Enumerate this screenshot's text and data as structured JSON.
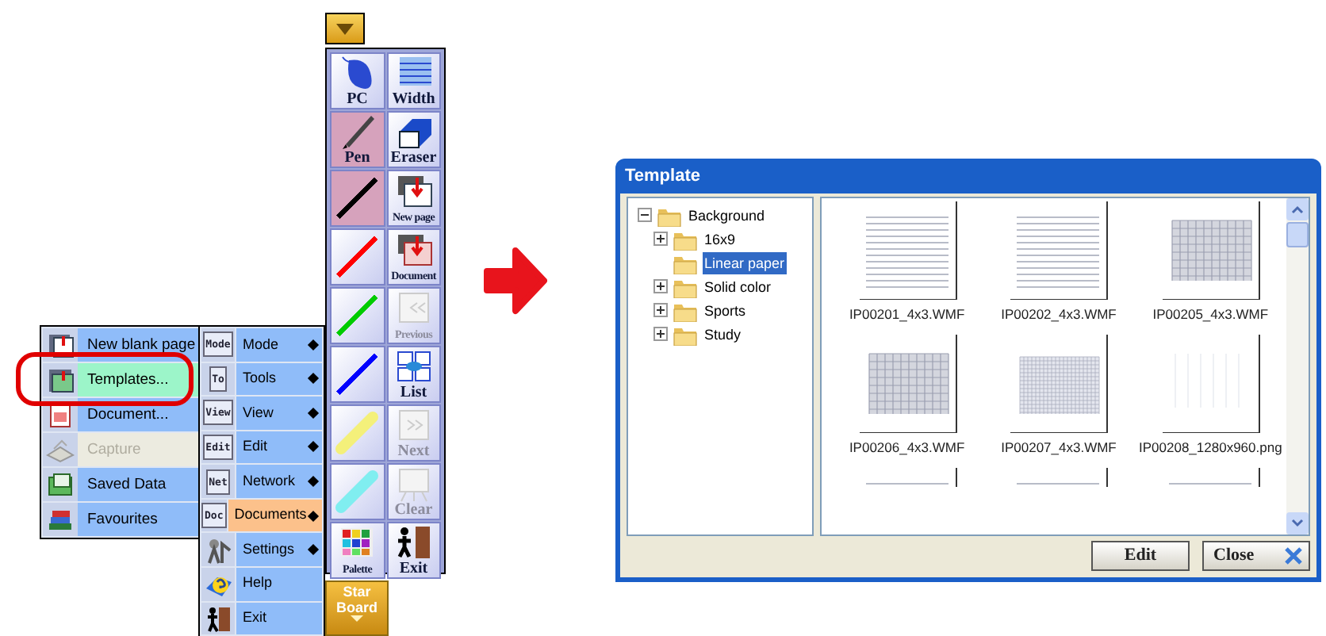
{
  "documents_submenu": {
    "items": [
      {
        "label": "New blank page",
        "selected": false,
        "disabled": false
      },
      {
        "label": "Templates...",
        "selected": true,
        "disabled": false
      },
      {
        "label": "Document...",
        "selected": false,
        "disabled": false
      },
      {
        "label": "Capture",
        "selected": false,
        "disabled": true
      },
      {
        "label": "Saved Data",
        "selected": false,
        "disabled": false
      },
      {
        "label": "Favourites",
        "selected": false,
        "disabled": false
      }
    ]
  },
  "main_menu": {
    "items": [
      {
        "badge": "Mode",
        "label": "Mode",
        "submenu": true,
        "selected": false
      },
      {
        "badge": "To",
        "label": "Tools",
        "submenu": true,
        "selected": false
      },
      {
        "badge": "View",
        "label": "View",
        "submenu": true,
        "selected": false
      },
      {
        "badge": "Edit",
        "label": "Edit",
        "submenu": true,
        "selected": false
      },
      {
        "badge": "Net",
        "label": "Network",
        "submenu": true,
        "selected": false
      },
      {
        "badge": "Doc",
        "label": "Documents",
        "submenu": true,
        "selected": true
      },
      {
        "label": "Settings",
        "submenu": true,
        "selected": false
      },
      {
        "label": "Help",
        "submenu": false,
        "selected": false
      },
      {
        "label": "Exit",
        "submenu": false,
        "selected": false
      }
    ]
  },
  "toolbar": {
    "tools": [
      {
        "kind": "button",
        "label": "PC",
        "selected": false,
        "disabled": false
      },
      {
        "kind": "button",
        "label": "Width",
        "selected": false,
        "disabled": false
      },
      {
        "kind": "button",
        "label": "Pen",
        "selected": true,
        "disabled": false
      },
      {
        "kind": "button",
        "label": "Eraser",
        "selected": false,
        "disabled": false
      },
      {
        "kind": "line",
        "color": "#000000",
        "selected": true
      },
      {
        "kind": "button",
        "label": "New page",
        "selected": false,
        "disabled": false
      },
      {
        "kind": "line",
        "color": "#ff0000",
        "selected": false
      },
      {
        "kind": "button",
        "label": "Document",
        "selected": false,
        "disabled": false
      },
      {
        "kind": "line",
        "color": "#00cc00",
        "selected": false
      },
      {
        "kind": "button",
        "label": "Previous",
        "selected": false,
        "disabled": true
      },
      {
        "kind": "line",
        "color": "#0000ff",
        "selected": false
      },
      {
        "kind": "button",
        "label": "List",
        "selected": false,
        "disabled": false
      },
      {
        "kind": "highlighter",
        "color": "#f4f07a",
        "selected": false
      },
      {
        "kind": "button",
        "label": "Next",
        "selected": false,
        "disabled": true
      },
      {
        "kind": "highlighter",
        "color": "#80eef0",
        "selected": false
      },
      {
        "kind": "button",
        "label": "Clear",
        "selected": false,
        "disabled": true
      },
      {
        "kind": "button",
        "label": "Palette",
        "selected": false,
        "disabled": false
      },
      {
        "kind": "button",
        "label": "Exit",
        "selected": false,
        "disabled": false
      }
    ]
  },
  "starboard_button": {
    "label": "Star Board"
  },
  "template_dialog": {
    "title": "Template",
    "tree": [
      {
        "label": "Background",
        "expanded": true,
        "selected": false,
        "children": [
          {
            "label": "16x9",
            "expanded": false,
            "selected": false
          },
          {
            "label": "Linear paper",
            "selected": true
          },
          {
            "label": "Solid color",
            "expanded": false,
            "selected": false
          },
          {
            "label": "Sports",
            "expanded": false,
            "selected": false
          },
          {
            "label": "Study",
            "expanded": false,
            "selected": false
          }
        ]
      }
    ],
    "thumbnails": [
      {
        "kind": "lines",
        "label": "IP00201_4x3.WMF"
      },
      {
        "kind": "lines",
        "label": "IP00202_4x3.WMF"
      },
      {
        "kind": "grid",
        "label": "IP00205_4x3.WMF"
      },
      {
        "kind": "grid",
        "label": "IP00206_4x3.WMF"
      },
      {
        "kind": "fine-grid",
        "label": "IP00207_4x3.WMF"
      },
      {
        "kind": "blank",
        "label": "IP00208_1280x960.png"
      },
      {
        "kind": "lines"
      },
      {
        "kind": "lines"
      },
      {
        "kind": "lines"
      }
    ],
    "buttons": [
      "Edit",
      "Close"
    ]
  }
}
